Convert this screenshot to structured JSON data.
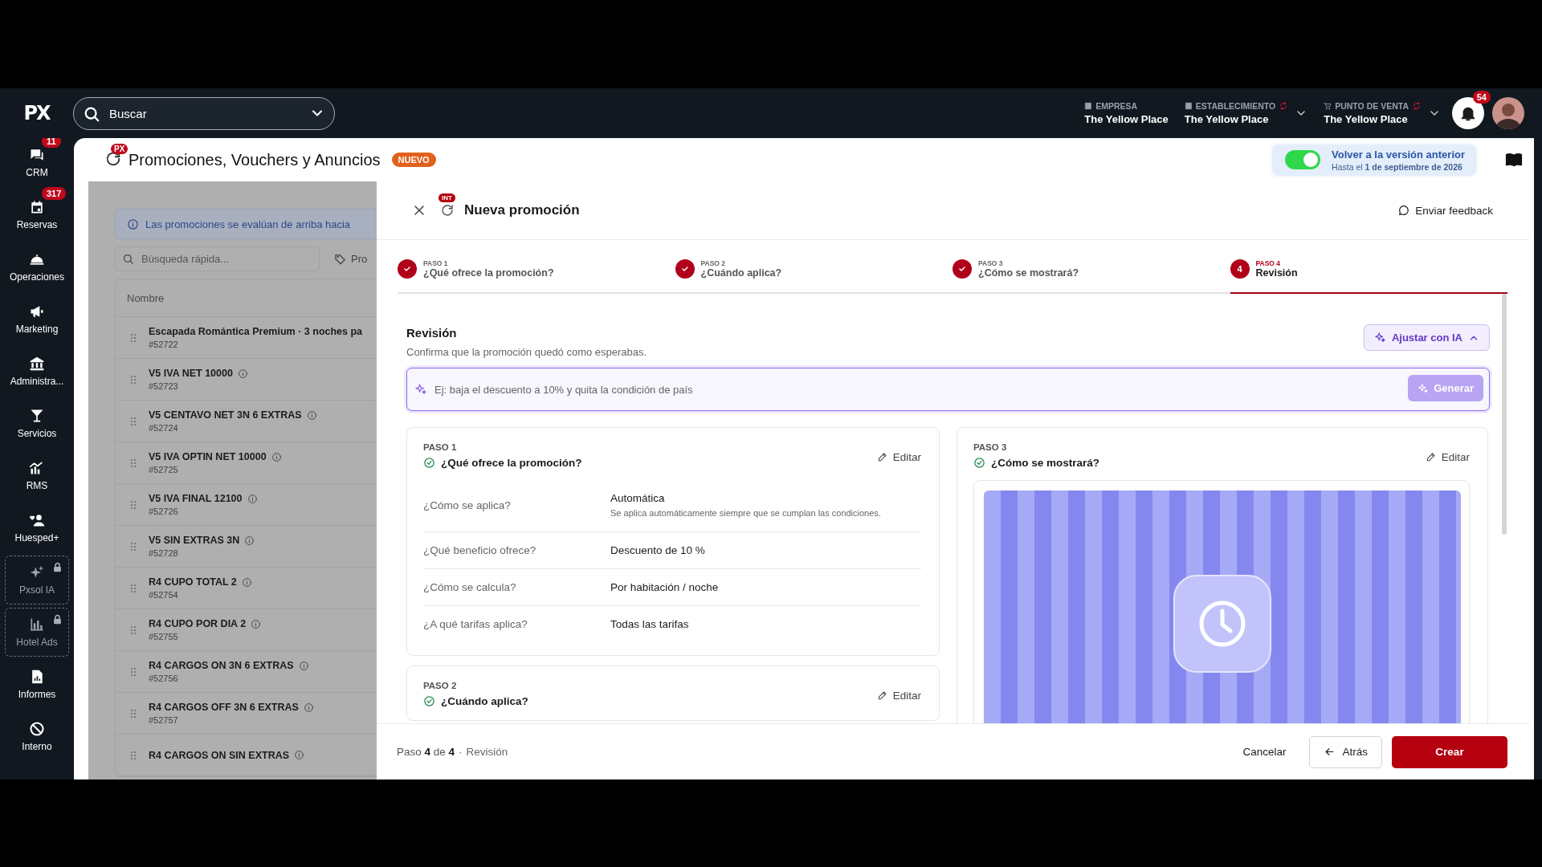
{
  "topbar": {
    "logo": "PX",
    "search": {
      "placeholder": "Buscar"
    },
    "context": [
      {
        "label": "EMPRESA",
        "value": "The Yellow Place",
        "alert": false,
        "dropdown": false
      },
      {
        "label": "ESTABLECIMIENTO",
        "value": "The Yellow Place",
        "alert": true,
        "dropdown": true
      },
      {
        "label": "PUNTO DE VENTA",
        "value": "The Yellow Place",
        "alert": true,
        "dropdown": true
      }
    ],
    "notifications": {
      "badge": "54"
    }
  },
  "sidebar": {
    "items": [
      {
        "label": "CRM",
        "badge": "11",
        "locked": false
      },
      {
        "label": "Reservas",
        "badge": "317",
        "locked": false
      },
      {
        "label": "Operaciones",
        "locked": false
      },
      {
        "label": "Marketing",
        "locked": false
      },
      {
        "label": "Administra...",
        "locked": false
      },
      {
        "label": "Servicios",
        "locked": false
      },
      {
        "label": "RMS",
        "locked": false
      },
      {
        "label": "Huesped+",
        "locked": false
      },
      {
        "label": "Pxsol IA",
        "locked": true
      },
      {
        "label": "Hotel Ads",
        "locked": true
      },
      {
        "label": "Informes",
        "locked": false
      },
      {
        "label": "Interno",
        "locked": false
      }
    ]
  },
  "page": {
    "badge": "PX",
    "title": "Promociones, Vouchers y Anuncios",
    "tag": "NUEVO",
    "legacy": {
      "title": "Volver a la versión anterior",
      "note": "Hasta el **1 de septiembre de 2026**",
      "on": true
    }
  },
  "list": {
    "notice": "Las promociones se evalúan de arriba hacia",
    "search": {
      "placeholder": "Búsqueda rápida..."
    },
    "filter": "Pro",
    "columns": [
      "Nombre"
    ],
    "rows": [
      {
        "name": "Escapada Romántica Premium · 3 noches pa",
        "id": "#52722",
        "info": false
      },
      {
        "name": "V5 IVA NET 10000",
        "id": "#52723",
        "info": true
      },
      {
        "name": "V5 CENTAVO NET 3N 6 EXTRAS",
        "id": "#52724",
        "info": true
      },
      {
        "name": "V5 IVA OPTIN NET 10000",
        "id": "#52725",
        "info": true
      },
      {
        "name": "V5 IVA FINAL 12100",
        "id": "#52726",
        "info": true
      },
      {
        "name": "V5 SIN EXTRAS 3N",
        "id": "#52728",
        "info": true
      },
      {
        "name": "R4 CUPO TOTAL 2",
        "id": "#52754",
        "info": true
      },
      {
        "name": "R4 CUPO POR DIA 2",
        "id": "#52755",
        "info": true
      },
      {
        "name": "R4 CARGOS ON 3N 6 EXTRAS",
        "id": "#52756",
        "info": true
      },
      {
        "name": "R4 CARGOS OFF 3N 6 EXTRAS",
        "id": "#52757",
        "info": true
      },
      {
        "name": "R4 CARGOS ON SIN EXTRAS",
        "info": true
      }
    ]
  },
  "modal": {
    "badge": "INT",
    "title": "Nueva promoción",
    "feedback": "Enviar feedback",
    "steps": [
      {
        "label": "PASO 1",
        "title": "¿Qué ofrece la promoción?",
        "done": true,
        "selected": false
      },
      {
        "label": "PASO 2",
        "title": "¿Cuándo aplica?",
        "done": true,
        "selected": false
      },
      {
        "label": "PASO 3",
        "title": "¿Cómo se mostrará?",
        "done": true,
        "selected": false
      },
      {
        "label": "PASO 4",
        "title": "Revisión",
        "number": "4",
        "done": false,
        "selected": true
      }
    ],
    "review": {
      "title": "Revisión",
      "subtitle": "Confirma que la promoción quedó como esperabas.",
      "ai_button": "Ajustar con IA",
      "ai_input": {
        "placeholder": "Ej: baja el descuento a 10% y quita la condición de país"
      },
      "generate": "Generar"
    },
    "cards_left": [
      {
        "step": "PASO 1",
        "title": "¿Qué ofrece la promoción?",
        "edit": "Editar",
        "done": true,
        "rows": [
          {
            "label": "¿Cómo se aplica?",
            "value": "Automática",
            "note": "Se aplica automáticamente siempre que se cumplan las condiciones."
          },
          {
            "label": "¿Qué beneficio ofrece?",
            "value": "Descuento de 10 %"
          },
          {
            "label": "¿Cómo se calcula?",
            "value": "Por habitación / noche"
          },
          {
            "label": "¿A qué tarifas aplica?",
            "value": "Todas las tarifas"
          }
        ]
      },
      {
        "step": "PASO 2",
        "title": "¿Cuándo aplica?",
        "edit": "Editar",
        "done": true
      }
    ],
    "cards_right": [
      {
        "step": "PASO 3",
        "title": "¿Cómo se mostrará?",
        "edit": "Editar",
        "done": true
      }
    ],
    "footer": {
      "progress": "Paso **4** de **4**",
      "separator": "·",
      "current": "Revisión",
      "cancel": "Cancelar",
      "back": "Atrás",
      "create": "Crear"
    }
  }
}
